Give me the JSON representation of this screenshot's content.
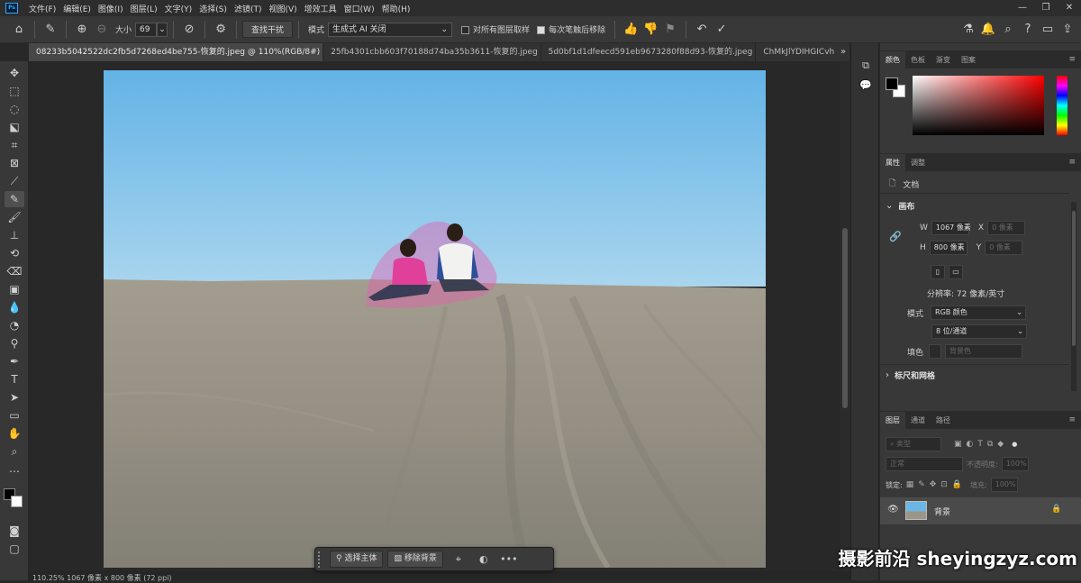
{
  "app": {
    "logo": "Ps"
  },
  "menu": [
    "文件(F)",
    "编辑(E)",
    "图像(I)",
    "图层(L)",
    "文字(Y)",
    "选择(S)",
    "滤镜(T)",
    "视图(V)",
    "增效工具",
    "窗口(W)",
    "帮助(H)"
  ],
  "window_controls": {
    "minimize": "—",
    "restore": "❐",
    "close": "✕"
  },
  "options_bar": {
    "size_label": "大小",
    "size_value": "69",
    "find_distractions": "查找干扰",
    "mode_label": "模式",
    "mode_value": "生成式 AI 关闭",
    "sample_all_layers": "对所有图层取样",
    "sample_all_checked": false,
    "remove_after_stroke": "每次笔触后移除",
    "remove_after_checked": true
  },
  "tabs": [
    {
      "label": "08233b5042522dc2fb5d7268ed4be755-恢复的.jpeg @ 110%(RGB/8#) *",
      "active": true,
      "close": "×"
    },
    {
      "label": "25fb4301cbb603f70188d74ba35b3611-恢复的.jpeg",
      "active": false,
      "close": "×"
    },
    {
      "label": "5d0bf1d1dfeecd591eb9673280f88d93-恢复的.jpeg",
      "active": false,
      "close": "×"
    },
    {
      "label": "ChMkJlYDIHGICvh",
      "active": false,
      "close": ""
    }
  ],
  "tabs_more": "»",
  "context_bar": {
    "select_subject": "选择主体",
    "remove_background": "移除背景",
    "more": "•••"
  },
  "status": "110.25%    1067 像素 x 800 像素 (72 ppi)",
  "color_panel": {
    "tabs": [
      "颜色",
      "色板",
      "渐变",
      "图案"
    ],
    "active": 0,
    "hue": "#ff0000"
  },
  "properties_panel": {
    "tabs": [
      "属性",
      "调整"
    ],
    "active": 0,
    "doc_label": "文档",
    "canvas_header": "画布",
    "w_label": "W",
    "w_value": "1067 像素",
    "h_label": "H",
    "h_value": "800 像素",
    "x_label": "X",
    "x_value": "0 像素",
    "y_label": "Y",
    "y_value": "0 像素",
    "resolution": "分辨率: 72 像素/英寸",
    "mode_label": "模式",
    "mode_value": "RGB 颜色",
    "depth_value": "8 位/通道",
    "fill_label": "填色",
    "fill_value": "背景色",
    "rulers_header": "标尺和网格"
  },
  "layers_panel": {
    "tabs": [
      "图层",
      "通道",
      "路径"
    ],
    "active": 0,
    "search_placeholder": "类型",
    "blend_mode": "正常",
    "opacity_label": "不透明度:",
    "opacity_value": "100%",
    "lock_label": "锁定:",
    "fill_label": "填充:",
    "fill_value": "100%",
    "layers": [
      {
        "name": "背景",
        "visible": true,
        "locked": true
      }
    ]
  },
  "watermark": "摄影前沿 sheyingzyz.com"
}
